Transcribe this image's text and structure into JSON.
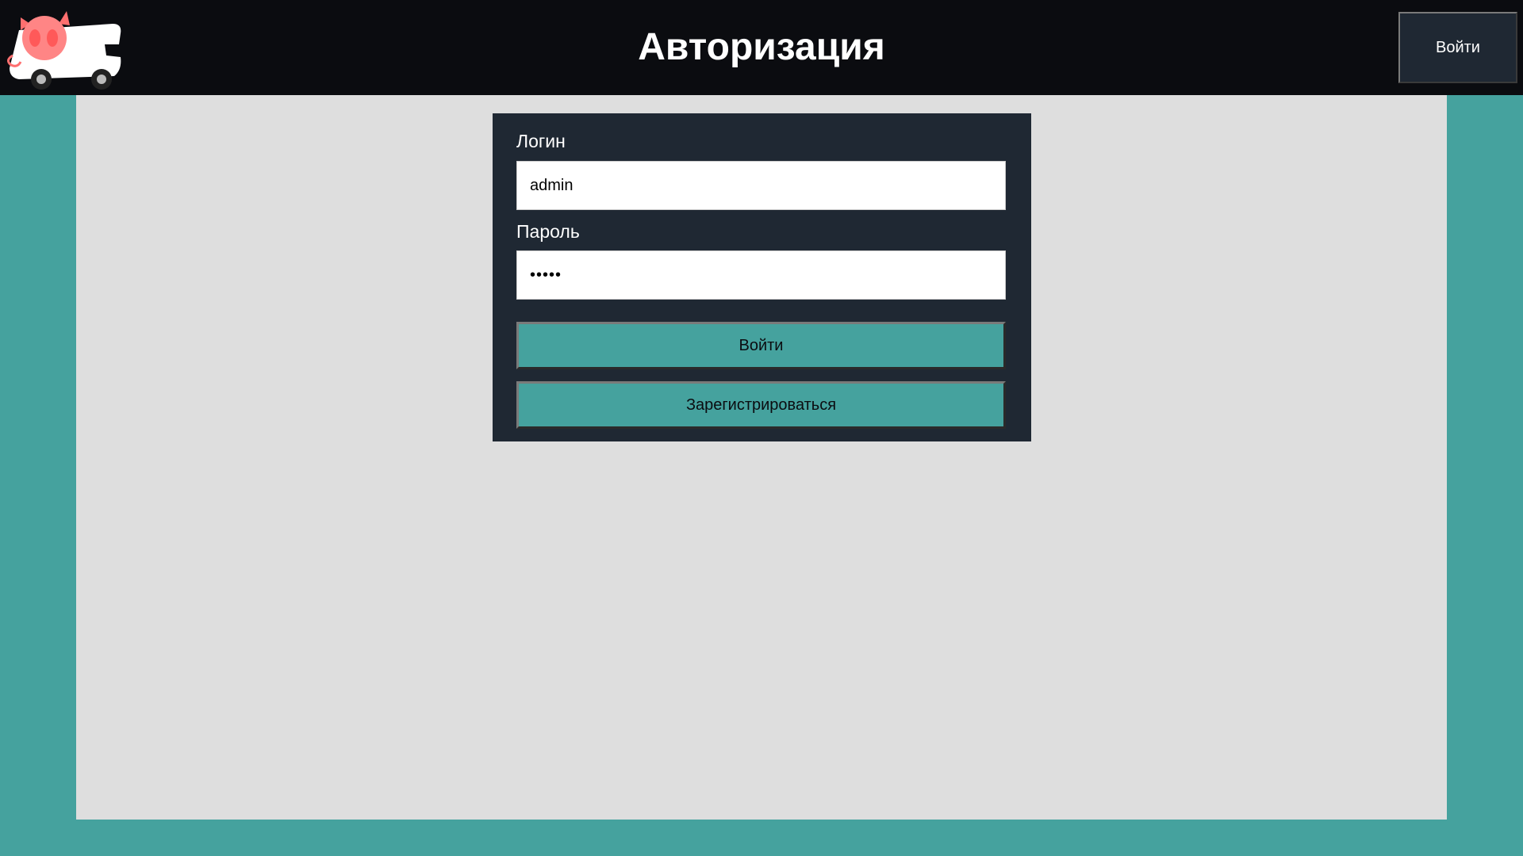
{
  "header": {
    "title": "Авторизация",
    "login_button_label": "Войти",
    "logo_icon": "pig-truck-logo"
  },
  "login_form": {
    "login_label": "Логин",
    "login_value": "admin",
    "password_label": "Пароль",
    "password_value": "admin",
    "submit_label": "Войти",
    "register_label": "Зарегистрироваться"
  },
  "colors": {
    "header_bg": "#0b0c10",
    "page_bg": "#45a29e",
    "content_bg": "#dedede",
    "panel_bg": "#1f2833",
    "accent": "#45a29e",
    "logo_pig": "#ff7b7b"
  }
}
